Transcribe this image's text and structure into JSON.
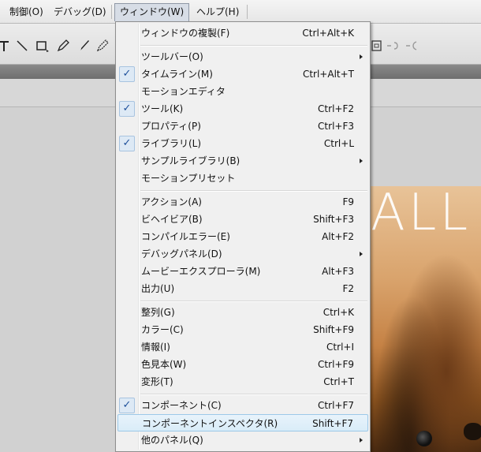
{
  "menubar": {
    "items": [
      {
        "label": "制御(O)"
      },
      {
        "label": "デバッグ(D)"
      },
      {
        "label": "ウィンドウ(W)"
      },
      {
        "label": "ヘルプ(H)"
      }
    ]
  },
  "toolbar": {
    "icons": [
      "text-tool-icon",
      "line-tool-icon",
      "rectangle-tool-icon",
      "pencil-tool-icon",
      "brush-tool-icon",
      "spray-brush-icon",
      "fit-frame-icon",
      "undo-icon",
      "redo-icon"
    ]
  },
  "stage": {
    "overlay_text": "ALL"
  },
  "menu": {
    "items": [
      {
        "label": "ウィンドウの複製(F)",
        "shortcut": "Ctrl+Alt+K"
      },
      {
        "label": "ツールバー(O)",
        "submenu": true
      },
      {
        "label": "タイムライン(M)",
        "shortcut": "Ctrl+Alt+T",
        "checked": true
      },
      {
        "label": "モーションエディタ"
      },
      {
        "label": "ツール(K)",
        "shortcut": "Ctrl+F2",
        "checked": true
      },
      {
        "label": "プロパティ(P)",
        "shortcut": "Ctrl+F3"
      },
      {
        "label": "ライブラリ(L)",
        "shortcut": "Ctrl+L",
        "checked": true
      },
      {
        "label": "サンプルライブラリ(B)",
        "submenu": true
      },
      {
        "label": "モーションプリセット"
      },
      {
        "label": "アクション(A)",
        "shortcut": "F9"
      },
      {
        "label": "ビヘイビア(B)",
        "shortcut": "Shift+F3"
      },
      {
        "label": "コンパイルエラー(E)",
        "shortcut": "Alt+F2"
      },
      {
        "label": "デバッグパネル(D)",
        "submenu": true
      },
      {
        "label": "ムービーエクスプローラ(M)",
        "shortcut": "Alt+F3"
      },
      {
        "label": "出力(U)",
        "shortcut": "F2"
      },
      {
        "label": "整列(G)",
        "shortcut": "Ctrl+K"
      },
      {
        "label": "カラー(C)",
        "shortcut": "Shift+F9"
      },
      {
        "label": "情報(I)",
        "shortcut": "Ctrl+I"
      },
      {
        "label": "色見本(W)",
        "shortcut": "Ctrl+F9"
      },
      {
        "label": "変形(T)",
        "shortcut": "Ctrl+T"
      },
      {
        "label": "コンポーネント(C)",
        "shortcut": "Ctrl+F7",
        "checked": true
      },
      {
        "label": "コンポーネントインスペクタ(R)",
        "shortcut": "Shift+F7",
        "highlighted": true
      },
      {
        "label": "他のパネル(Q)",
        "submenu": true
      }
    ],
    "check_glyph": "✓"
  },
  "colors": {
    "menu_bg": "#f0f0f0",
    "highlight_border": "#9cc8e8",
    "check_color": "#1d4f9a"
  }
}
